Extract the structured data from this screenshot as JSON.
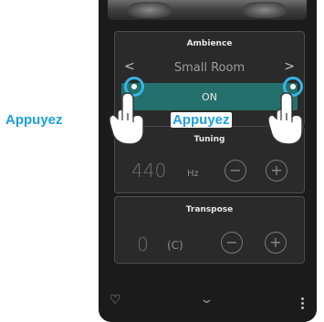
{
  "ambience": {
    "title": "Ambience",
    "value": "Small Room",
    "toggle_label": "ON"
  },
  "tuning": {
    "title": "Tuning",
    "value": "440",
    "unit": "Hz",
    "minus": "−",
    "plus": "+"
  },
  "transpose": {
    "title": "Transpose",
    "value": "0",
    "key": "(C)",
    "minus": "−",
    "plus": "+"
  },
  "annotations": {
    "left_label": "Appuyez",
    "center_label": "Appuyez"
  },
  "icons": {
    "left_arrow": "chevron-left-icon",
    "right_arrow": "chevron-right-icon",
    "heart": "heart-icon",
    "expand": "chevron-down-icon",
    "menu": "more-vertical-icon",
    "tap_indicator": "tap-hand-icon"
  },
  "colors": {
    "toggle_on": "#24706c",
    "annotation": "#1da0e0"
  }
}
